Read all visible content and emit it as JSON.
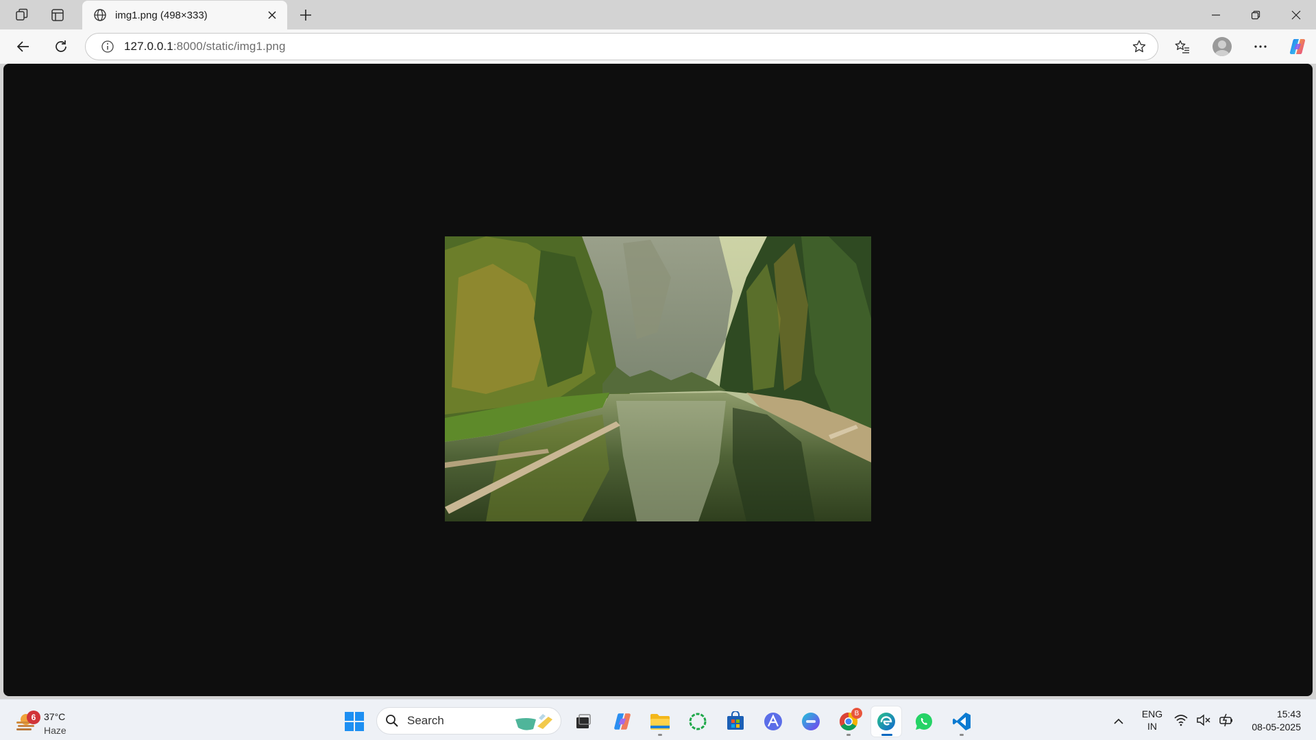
{
  "browser": {
    "tab_title": "img1.png (498×333)",
    "url_host": "127.0.0.1",
    "url_path": ":8000/static/img1.png"
  },
  "page": {
    "image_subject": "forest river landscape photo"
  },
  "taskbar": {
    "weather": {
      "temp": "37°C",
      "desc": "Haze",
      "badge": "6"
    },
    "search_placeholder": "Search",
    "language": {
      "line1": "ENG",
      "line2": "IN"
    },
    "clock": {
      "time": "15:43",
      "date": "08-05-2025"
    },
    "chrome_badge": "B"
  }
}
